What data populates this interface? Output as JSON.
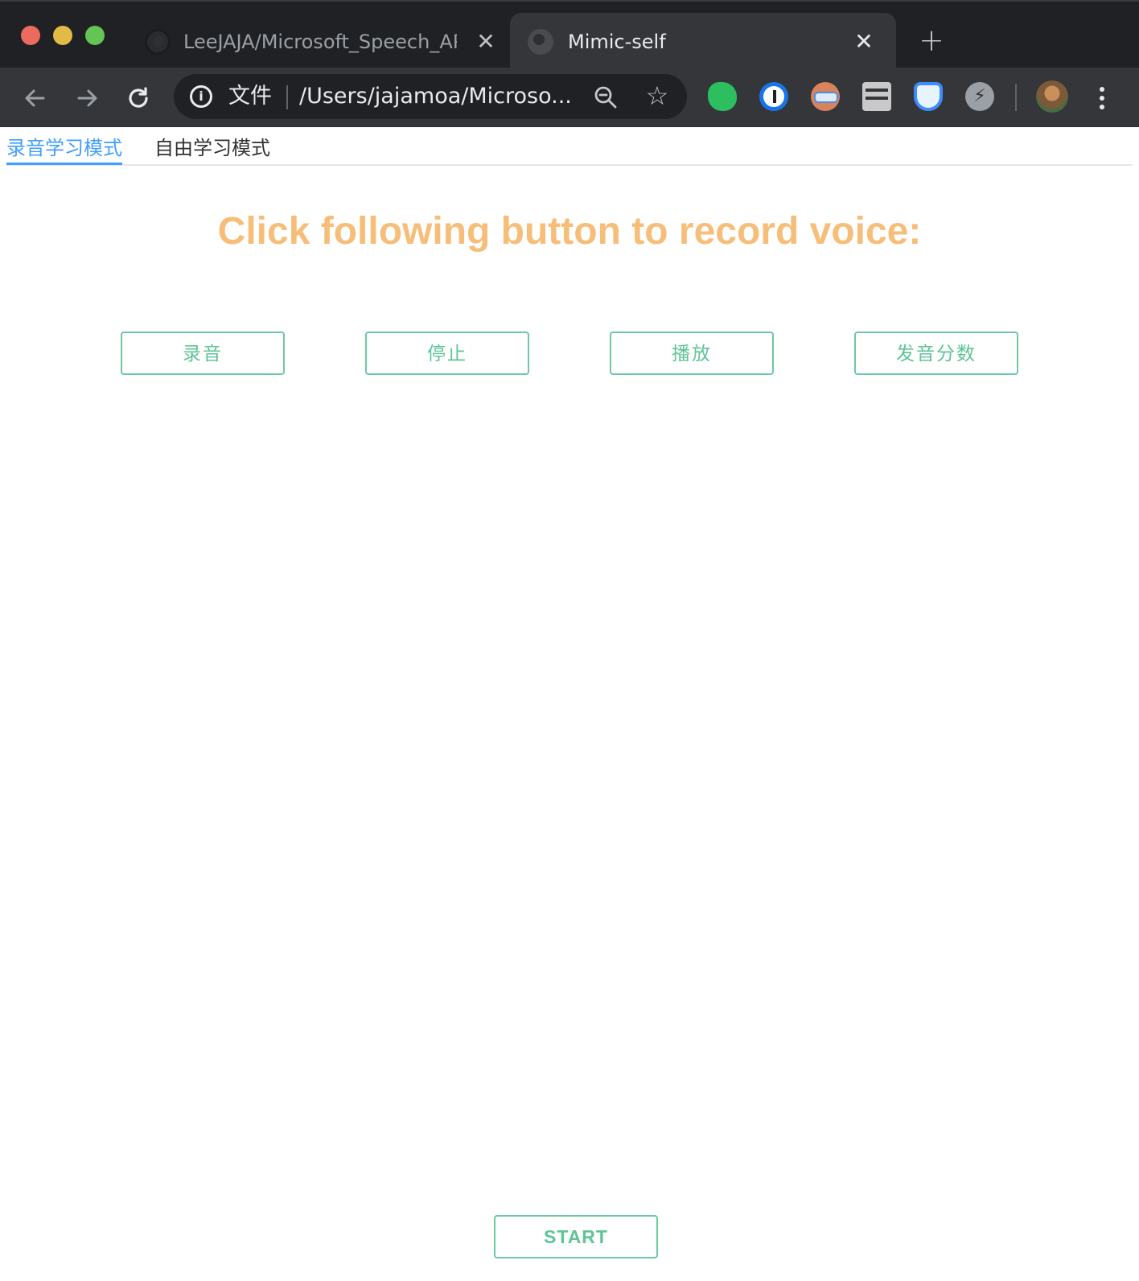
{
  "browser": {
    "tabs": [
      {
        "title": "LeeJAJA/Microsoft_Speech_AP",
        "active": false,
        "favicon": "github-icon"
      },
      {
        "title": "Mimic-self",
        "active": true,
        "favicon": "globe-icon"
      }
    ],
    "new_tab_symbol": "+",
    "close_symbol": "✕",
    "omnibox": {
      "scheme_label": "文件",
      "url": "/Users/jajamoa/Microso..."
    },
    "extensions": [
      "evernote-icon",
      "1password-icon",
      "avatar-extension-icon",
      "reader-icon",
      "diamond-icon",
      "bolt-icon"
    ]
  },
  "page": {
    "mode_tabs": [
      {
        "label": "录音学习模式",
        "active": true
      },
      {
        "label": "自由学习模式",
        "active": false
      }
    ],
    "headline": "Click following button to record voice:",
    "buttons": {
      "record": "录音",
      "stop": "停止",
      "play": "播放",
      "score": "发音分数"
    },
    "start_label": "START"
  },
  "colors": {
    "headline": "#f7be7a",
    "button_border": "#6ccaa0",
    "button_text": "#5fc497",
    "active_tab": "#409eff",
    "chrome_dark": "#202124",
    "chrome_toolbar": "#35363a"
  }
}
